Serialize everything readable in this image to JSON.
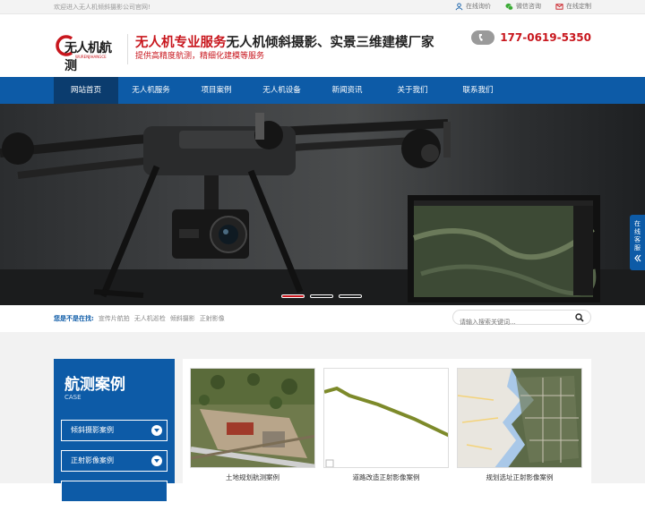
{
  "topbar": {
    "welcome": "欢迎进入无人机倾斜摄影公司官网!",
    "links": [
      {
        "label": "在线询价",
        "icon": "person-icon"
      },
      {
        "label": "微信咨询",
        "icon": "wechat-icon"
      },
      {
        "label": "在线定制",
        "icon": "mail-icon"
      }
    ]
  },
  "header": {
    "logo_text": "无人机航测",
    "logo_sub": "WURENJIHANGCE",
    "slogan_red": "无人机专业服务",
    "slogan_dark": "无人机倾斜摄影、实景三维建模厂家",
    "tagline": "提供高精度航测，精细化建模等服务",
    "phone": "177-0619-5350",
    "phone_icon": "phone-icon"
  },
  "nav": {
    "items": [
      "网站首页",
      "无人机服务",
      "项目案例",
      "无人机设备",
      "新闻资讯",
      "关于我们",
      "联系我们"
    ],
    "active_index": 0
  },
  "banner": {
    "slides": 3,
    "active_slide": 0
  },
  "float": {
    "label": "在线客服",
    "icon": "double-chevron-left-icon"
  },
  "crumbbar": {
    "lead": "您是不是在找:",
    "keywords": [
      "宣传片航拍",
      "无人机巡检",
      "倾斜摄影",
      "正射影像"
    ],
    "search_placeholder": "请输入搜索关键词..."
  },
  "sidebar": {
    "title": "航测案例",
    "subtitle": "CASE",
    "items": [
      "倾斜摄影案例",
      "正射影像案例",
      ""
    ]
  },
  "cases": [
    {
      "caption": "土地规划航测案例"
    },
    {
      "caption": "道路改造正射影像案例"
    },
    {
      "caption": "规划选址正射影像案例"
    }
  ],
  "colors": {
    "brand_blue": "#0d5ba7",
    "brand_red": "#c8161d",
    "nav_active": "#0b3c6e"
  }
}
